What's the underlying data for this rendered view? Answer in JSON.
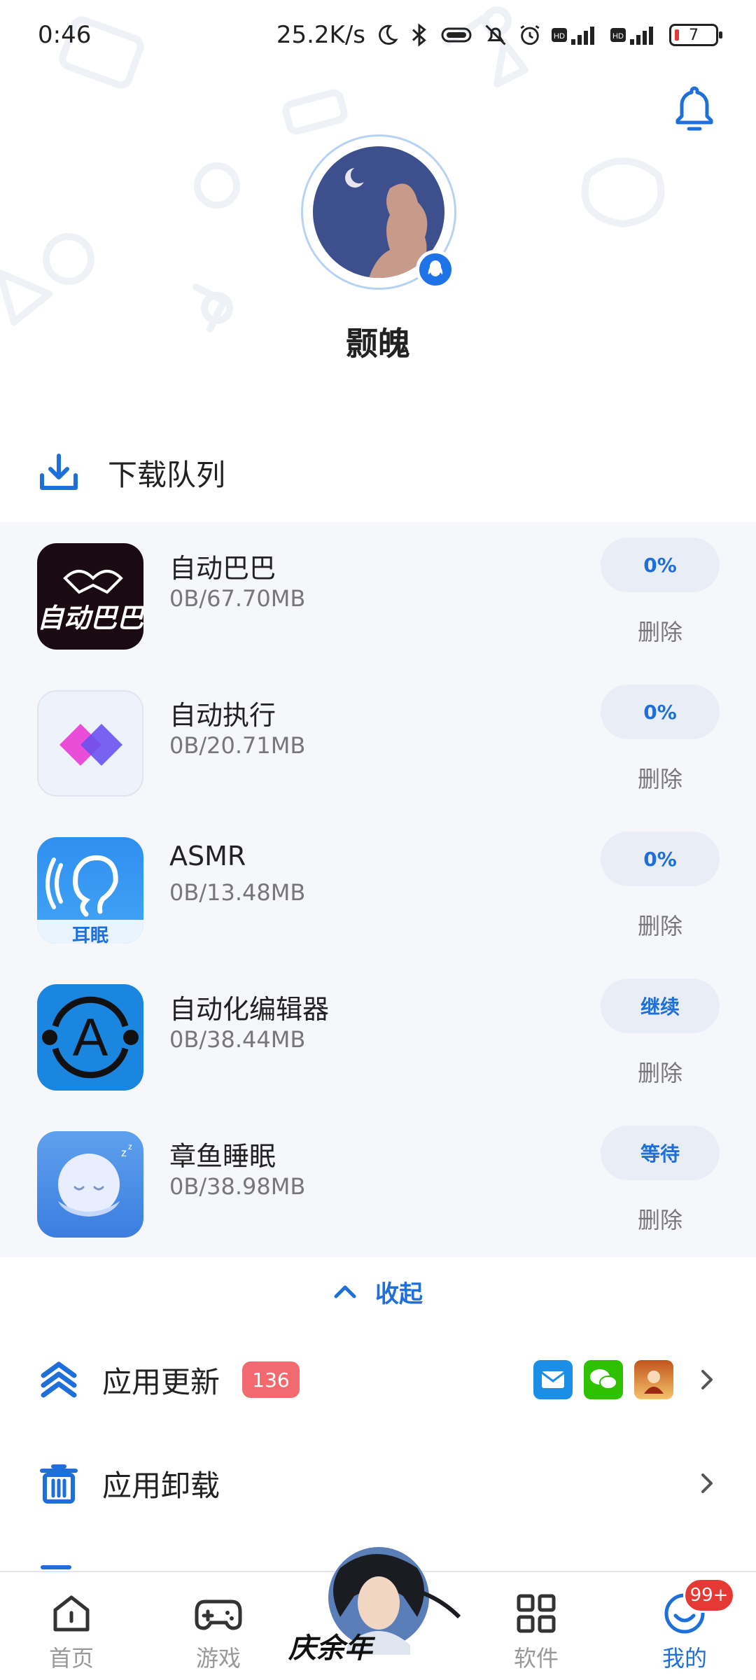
{
  "status_bar": {
    "time": "0:46",
    "net_speed": "25.2K/s",
    "signal1": "4G",
    "signal2": "4G+",
    "battery": "7"
  },
  "profile": {
    "username": "颢魄"
  },
  "download_queue": {
    "title": "下载队列",
    "items": [
      {
        "name": "自动巴巴",
        "size": "0B/67.70MB",
        "action": "0%",
        "delete": "删除",
        "icon": "zidong-baba-logo"
      },
      {
        "name": "自动执行",
        "size": "0B/20.71MB",
        "action": "0%",
        "delete": "删除",
        "icon": "zidong-zhixing-logo"
      },
      {
        "name": "ASMR",
        "size": "0B/13.48MB",
        "action": "0%",
        "delete": "删除",
        "icon": "ear-sleep-logo",
        "icon_text": "耳眠"
      },
      {
        "name": "自动化编辑器",
        "size": "0B/38.44MB",
        "action": "继续",
        "delete": "删除",
        "icon": "automation-editor-logo"
      },
      {
        "name": "章鱼睡眠",
        "size": "0B/38.98MB",
        "action": "等待",
        "delete": "删除",
        "icon": "octopus-sleep-logo"
      }
    ],
    "collapse_label": "收起"
  },
  "menu": {
    "updates_label": "应用更新",
    "updates_count": "136",
    "uninstall_label": "应用卸载"
  },
  "bottom_nav": {
    "home": "首页",
    "games": "游戏",
    "software": "软件",
    "mine": "我的",
    "mine_badge": "99+",
    "promo_text": "庆余年"
  },
  "colors": {
    "accent": "#1e6fd9",
    "badge_red": "#f26a6f",
    "panel_bg": "#f6f7fb"
  }
}
